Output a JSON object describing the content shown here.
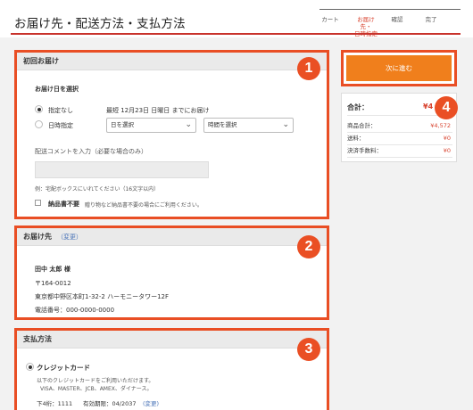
{
  "header": {
    "title": "お届け先・配送方法・支払方法",
    "steps": [
      {
        "label": "カート",
        "active": false
      },
      {
        "label": "お届け先・\n日時指定",
        "active": true
      },
      {
        "label": "確認",
        "active": false
      },
      {
        "label": "完了",
        "active": false
      }
    ]
  },
  "delivery_first": {
    "title": "初回お届け",
    "badge": "1",
    "date_heading": "お届け日を選択",
    "option_none_label": "指定なし",
    "option_none_note": "最短 12月23日 日曜日 までにお届け",
    "option_datetime_label": "日時指定",
    "day_select": "日を選択",
    "time_select": "時間を選択",
    "comment_label": "配送コメントを入力（必要な場合のみ）",
    "comment_value": "",
    "comment_example": "例：宅配ボックスにいれてください（16文字以内）",
    "no_receipt_label": "納品書不要",
    "no_receipt_note": "贈り物など納品書不要の場合にご利用ください。"
  },
  "address": {
    "title": "お届け先",
    "change_link": "（変更）",
    "badge": "2",
    "name": "田中 太郎 様",
    "postal": "〒164-0012",
    "street": "東京都中野区本町1-32-2 ハーモニータワー12F",
    "phone": "電話番号：000-0000-0000"
  },
  "payment": {
    "title": "支払方法",
    "badge": "3",
    "method": "クレジットカード",
    "note_line1": "以下のクレジットカードをご利用いただけます。",
    "note_line2": "VISA、MASTER、JCB、AMEX、ダイナース。",
    "last4": "下4桁：1111",
    "expiry": "有効期限：04/2037",
    "change_link": "(変更)"
  },
  "sidebar": {
    "next_button": "次に進む",
    "badge": "4",
    "total_label": "合計：",
    "total_value": "¥4",
    "rows": [
      {
        "label": "商品合計：",
        "value": "¥4,572"
      },
      {
        "label": "送料：",
        "value": "¥0"
      },
      {
        "label": "決済手数料：",
        "value": "¥0"
      }
    ]
  },
  "colors": {
    "accent": "#e94e24",
    "button": "#f07f1c",
    "link": "#4a74b8",
    "price": "#d8432f"
  }
}
